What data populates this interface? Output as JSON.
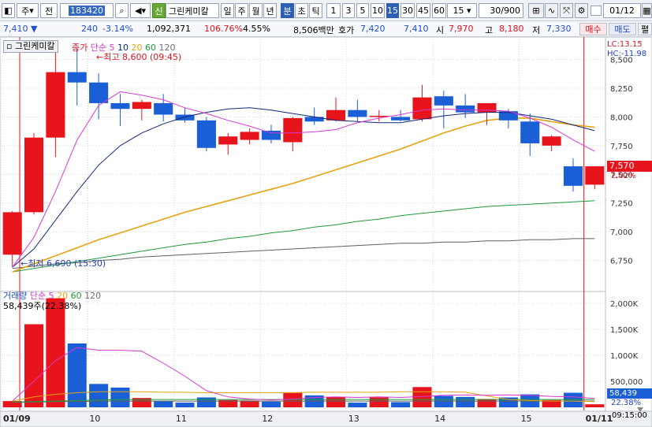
{
  "toolbar": {
    "period_button": "주",
    "all_button": "전",
    "stock_code": "183420",
    "stock_badge": "신",
    "stock_name": "그린케미칼",
    "timeframes": [
      "일",
      "주",
      "월",
      "년",
      "분",
      "초",
      "틱"
    ],
    "active_timeframe": "분",
    "intervals": [
      "1",
      "3",
      "5",
      "10",
      "15",
      "30",
      "45",
      "60"
    ],
    "active_interval": "15",
    "interval_select": "15",
    "count": "30/900",
    "date": "01/12",
    "icons": [
      "grid-icon",
      "search-icon",
      "speaker-icon",
      "menu-icon",
      "chart-type-icon",
      "cross-icon",
      "settings-icon"
    ]
  },
  "quote": {
    "price": "7,410",
    "change": "240",
    "change_pct": "-3.14%",
    "volume": "1,092,371",
    "volume_ratio": "106.76%",
    "turnover": "4.55%",
    "amount": "8,506백만",
    "ask_label": "호가",
    "ask": "7,420",
    "bid": "7,410",
    "open_label": "시",
    "open": "7,970",
    "high_label": "고",
    "high": "8,180",
    "low_label": "저",
    "low": "7,330",
    "buy_button": "매수",
    "sell_button": "매도",
    "extra_button": "펼"
  },
  "chart_data": [
    {
      "type": "candlestick",
      "title": "그린케미칼",
      "legend": {
        "series": "종가",
        "ma_type": "단순",
        "periods": [
          "5",
          "10",
          "20",
          "60",
          "120"
        ]
      },
      "ylim": [
        6500,
        8600
      ],
      "y_ticks": [
        "8,500",
        "8,250",
        "8,000",
        "7,750",
        "7,500",
        "7,250",
        "7,000",
        "6,750"
      ],
      "annotations": {
        "high": "최고 8,600 (09:45)",
        "low": "최저 6,690 (15:30)",
        "lc": "LC:13.15",
        "hc": "HC:-11.98",
        "last_price": "7,570",
        "last_pct": "2.02%"
      },
      "candles": [
        {
          "o": 6800,
          "h": 7180,
          "l": 6690,
          "c": 7170
        },
        {
          "o": 7170,
          "h": 7860,
          "l": 7150,
          "c": 7820
        },
        {
          "o": 7820,
          "h": 8600,
          "l": 7650,
          "c": 8390
        },
        {
          "o": 8390,
          "h": 8600,
          "l": 8100,
          "c": 8300
        },
        {
          "o": 8300,
          "h": 8380,
          "l": 7980,
          "c": 8120
        },
        {
          "o": 8120,
          "h": 8200,
          "l": 7920,
          "c": 8070
        },
        {
          "o": 8070,
          "h": 8150,
          "l": 7970,
          "c": 8130
        },
        {
          "o": 8120,
          "h": 8200,
          "l": 7960,
          "c": 8020
        },
        {
          "o": 8020,
          "h": 8080,
          "l": 7950,
          "c": 7970
        },
        {
          "o": 7970,
          "h": 8000,
          "l": 7700,
          "c": 7730
        },
        {
          "o": 7760,
          "h": 7860,
          "l": 7670,
          "c": 7830
        },
        {
          "o": 7800,
          "h": 7900,
          "l": 7760,
          "c": 7870
        },
        {
          "o": 7880,
          "h": 7930,
          "l": 7770,
          "c": 7800
        },
        {
          "o": 7780,
          "h": 8000,
          "l": 7700,
          "c": 7990
        },
        {
          "o": 8000,
          "h": 8080,
          "l": 7930,
          "c": 7960
        },
        {
          "o": 7970,
          "h": 8170,
          "l": 7960,
          "c": 8060
        },
        {
          "o": 8060,
          "h": 8150,
          "l": 7960,
          "c": 8000
        },
        {
          "o": 8000,
          "h": 8060,
          "l": 7960,
          "c": 8010
        },
        {
          "o": 8000,
          "h": 8060,
          "l": 7960,
          "c": 7970
        },
        {
          "o": 7980,
          "h": 8280,
          "l": 7960,
          "c": 8170
        },
        {
          "o": 8180,
          "h": 8230,
          "l": 7900,
          "c": 8100
        },
        {
          "o": 8100,
          "h": 8200,
          "l": 7990,
          "c": 8040
        },
        {
          "o": 8040,
          "h": 8120,
          "l": 7930,
          "c": 8120
        },
        {
          "o": 8050,
          "h": 8070,
          "l": 7900,
          "c": 7970
        },
        {
          "o": 7960,
          "h": 8030,
          "l": 7660,
          "c": 7770
        },
        {
          "o": 7750,
          "h": 7840,
          "l": 7700,
          "c": 7830
        },
        {
          "o": 7570,
          "h": 7640,
          "l": 7350,
          "c": 7400
        },
        {
          "o": 7410,
          "h": 7570,
          "l": 7370,
          "c": 7570
        }
      ],
      "ma5": [
        6690,
        6950,
        7350,
        7800,
        8100,
        8220,
        8190,
        8150,
        8080,
        8030,
        7970,
        7920,
        7860,
        7860,
        7870,
        7890,
        7950,
        7990,
        8020,
        8060,
        8070,
        8060,
        8060,
        8050,
        7990,
        7910,
        7800,
        7700
      ],
      "ma10": [
        6690,
        6850,
        7100,
        7350,
        7580,
        7750,
        7860,
        7940,
        8000,
        8040,
        8070,
        8080,
        8060,
        8030,
        8000,
        7970,
        7960,
        7950,
        7950,
        7980,
        8010,
        8030,
        8040,
        8040,
        8010,
        7980,
        7930,
        7880
      ],
      "ma20": [
        6650,
        6720,
        6790,
        6860,
        6930,
        6990,
        7050,
        7110,
        7170,
        7220,
        7270,
        7320,
        7370,
        7420,
        7480,
        7540,
        7600,
        7660,
        7720,
        7790,
        7860,
        7920,
        7970,
        7990,
        7990,
        7960,
        7930,
        7910
      ],
      "ma60": [
        6650,
        6680,
        6710,
        6740,
        6770,
        6800,
        6830,
        6860,
        6890,
        6910,
        6940,
        6960,
        6990,
        7010,
        7040,
        7060,
        7090,
        7110,
        7140,
        7160,
        7180,
        7200,
        7220,
        7230,
        7240,
        7250,
        7260,
        7270
      ],
      "ma120": [
        6680,
        6700,
        6720,
        6730,
        6750,
        6760,
        6780,
        6790,
        6800,
        6810,
        6820,
        6830,
        6840,
        6850,
        6860,
        6870,
        6880,
        6890,
        6900,
        6900,
        6910,
        6910,
        6920,
        6920,
        6930,
        6930,
        6940,
        6940
      ]
    },
    {
      "type": "bar",
      "title": "거래량",
      "legend": {
        "ma_type": "단순",
        "periods": [
          "5",
          "20",
          "60",
          "120"
        ]
      },
      "ylim": [
        0,
        2200
      ],
      "y_ticks": [
        "2,000K",
        "1,500K",
        "1,000K",
        "500,000"
      ],
      "annotations": {
        "current": "58,439주(22.38%)",
        "last_value": "58,439",
        "last_pct": "22.38%"
      },
      "values": [
        120,
        1600,
        2100,
        1230,
        450,
        380,
        180,
        120,
        90,
        190,
        140,
        130,
        110,
        290,
        230,
        200,
        90,
        190,
        100,
        390,
        220,
        200,
        160,
        190,
        250,
        140,
        280,
        58
      ],
      "ma5": [
        120,
        500,
        900,
        1150,
        1100,
        1100,
        1080,
        850,
        600,
        320,
        200,
        160,
        140,
        160,
        190,
        200,
        190,
        200,
        190,
        210,
        230,
        240,
        230,
        240,
        230,
        210,
        200,
        170
      ],
      "ma20": [
        120,
        200,
        250,
        280,
        300,
        300,
        300,
        290,
        290,
        280,
        280,
        280,
        280,
        280,
        290,
        290,
        290,
        290,
        300,
        300,
        300,
        290,
        220,
        150,
        130,
        120,
        120,
        110
      ],
      "ma60": [
        100,
        110,
        120,
        130,
        140,
        150,
        150,
        150,
        150,
        150,
        150,
        150,
        150,
        150,
        150,
        150,
        150,
        150,
        150,
        150,
        150,
        150,
        150,
        150,
        150,
        150,
        150,
        150
      ],
      "ma120": [
        100,
        100,
        110,
        110,
        120,
        120,
        120,
        120,
        120,
        120,
        120,
        120,
        120,
        120,
        120,
        120,
        120,
        120,
        120,
        120,
        120,
        120,
        120,
        120,
        120,
        120,
        120,
        120
      ]
    }
  ],
  "xaxis": {
    "labels": [
      {
        "text": "01/09",
        "bar": 0,
        "bold": true
      },
      {
        "text": "10",
        "bar": 4
      },
      {
        "text": "11",
        "bar": 8
      },
      {
        "text": "12",
        "bar": 12
      },
      {
        "text": "13",
        "bar": 16
      },
      {
        "text": "14",
        "bar": 20
      },
      {
        "text": "15",
        "bar": 24
      },
      {
        "text": "01/11",
        "bar": 27,
        "bold": true
      }
    ],
    "time_readout": "09:15:00"
  },
  "colors": {
    "up": "#e8141c",
    "down": "#1a5fd6",
    "ma5": "#d63ad0",
    "ma10": "#10287a",
    "ma20": "#e6a212",
    "ma60": "#1f9a3a",
    "ma120": "#606060",
    "grid": "#d6d9e0"
  }
}
